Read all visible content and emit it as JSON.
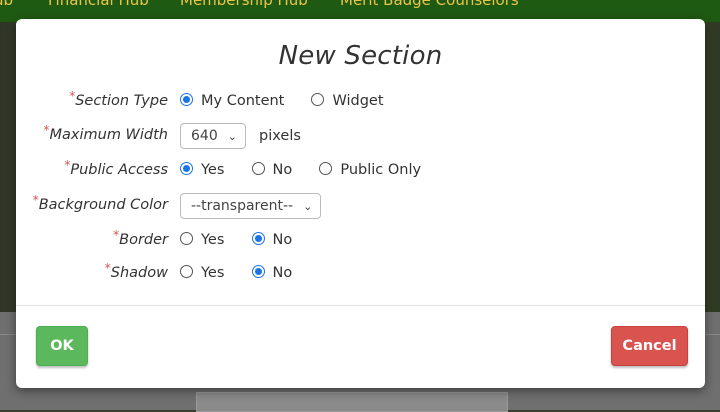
{
  "background": {
    "nav_items": [
      "ub",
      "Financial Hub",
      "Membership Hub",
      "Merit Badge Counselors"
    ]
  },
  "modal": {
    "title": "New Section",
    "rows": {
      "section_type": {
        "required": "*",
        "label": "Section Type",
        "options": [
          "My Content",
          "Widget"
        ],
        "selected": "My Content"
      },
      "max_width": {
        "required": "*",
        "label": "Maximum Width",
        "value": "640",
        "suffix": "pixels"
      },
      "public_access": {
        "required": "*",
        "label": "Public Access",
        "options": [
          "Yes",
          "No",
          "Public Only"
        ],
        "selected": "Yes"
      },
      "background_color": {
        "required": "*",
        "label": "Background Color",
        "value": "--transparent--"
      },
      "border": {
        "required": "*",
        "label": "Border",
        "options": [
          "Yes",
          "No"
        ],
        "selected": "No"
      },
      "shadow": {
        "required": "*",
        "label": "Shadow",
        "options": [
          "Yes",
          "No"
        ],
        "selected": "No"
      }
    },
    "buttons": {
      "ok": "OK",
      "cancel": "Cancel"
    }
  },
  "colors": {
    "ok": "#5cb85c",
    "cancel": "#d9534f",
    "radio_checked": "#1a73e8",
    "required_marker": "#d9534f",
    "nav_bg": "#1f5a12",
    "nav_text": "#e8c54a"
  }
}
